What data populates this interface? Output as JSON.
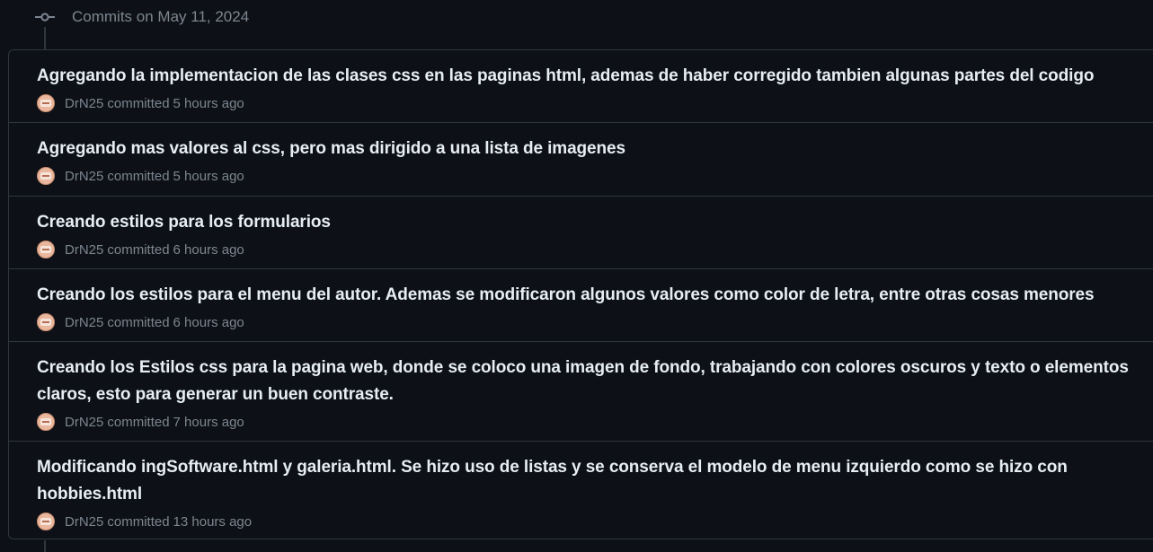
{
  "group": {
    "title": "Commits on May 11, 2024"
  },
  "commits": [
    {
      "title": "Agregando la implementacion de las clases css en las paginas html, ademas de haber corregido tambien algunas partes del codigo",
      "author": "DrN25",
      "action": "committed",
      "time": "5 hours ago"
    },
    {
      "title": "Agregando mas valores al css, pero mas dirigido a una lista de imagenes",
      "author": "DrN25",
      "action": "committed",
      "time": "5 hours ago"
    },
    {
      "title": "Creando estilos para los formularios",
      "author": "DrN25",
      "action": "committed",
      "time": "6 hours ago"
    },
    {
      "title": "Creando los estilos para el menu del autor. Ademas se modificaron algunos valores como color de letra, entre otras cosas menores",
      "author": "DrN25",
      "action": "committed",
      "time": "6 hours ago"
    },
    {
      "title": "Creando los Estilos css para la pagina web, donde se coloco una imagen de fondo, trabajando con colores oscuros y texto o elementos claros, esto para generar un buen contraste.",
      "author": "DrN25",
      "action": "committed",
      "time": "7 hours ago"
    },
    {
      "title": "Modificando ingSoftware.html y galeria.html. Se hizo uso de listas y se conserva el modelo de menu izquierdo como se hizo con hobbies.html",
      "author": "DrN25",
      "action": "committed",
      "time": "13 hours ago"
    }
  ],
  "colors": {
    "background": "#0d1117",
    "border": "#30363d",
    "title_text": "#e6edf3",
    "muted_text": "#7d8590"
  }
}
